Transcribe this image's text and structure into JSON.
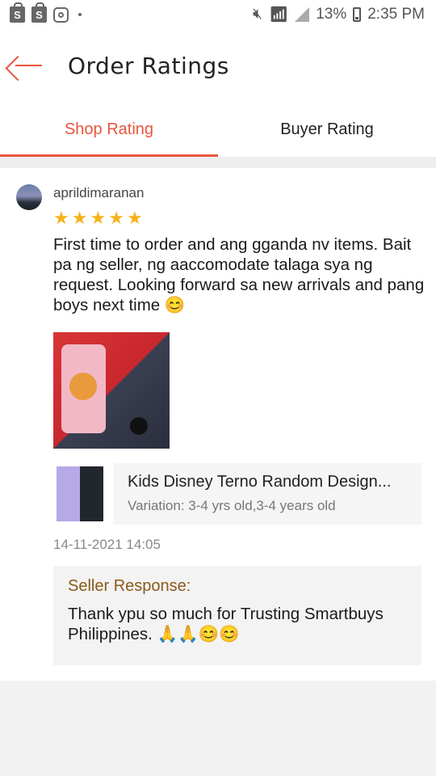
{
  "status_bar": {
    "battery": "13%",
    "time": "2:35 PM",
    "left_icons": [
      "shopping-bag-icon",
      "shopping-bag-icon",
      "instagram-icon",
      "dot-icon"
    ],
    "right_icons": [
      "mute-icon",
      "wifi-icon",
      "signal-icon",
      "battery-icon"
    ]
  },
  "header": {
    "title": "Order Ratings",
    "back_icon": "arrow-left-icon",
    "accent_color": "#e8553d"
  },
  "tabs": [
    {
      "label": "Shop Rating",
      "active": true
    },
    {
      "label": "Buyer Rating",
      "active": false
    }
  ],
  "review": {
    "username": "aprildimaranan",
    "rating": 5,
    "rating_max": 5,
    "comment": "First time to order and ang gganda nv items. Bait pa ng seller, ng aaccomodate talaga sya ng request. Looking forward sa new arrivals and pang boys next time",
    "comment_emoji": "😊",
    "product": {
      "name": "Kids Disney Terno Random Design...",
      "variation": "Variation: 3-4 yrs old,3-4 years old"
    },
    "date": "14-11-2021 14:05",
    "seller_response": {
      "label": "Seller Response:",
      "text": "Thank ypu so much for Trusting Smartbuys Philippines.",
      "emojis": "🙏🙏😊😊"
    }
  }
}
